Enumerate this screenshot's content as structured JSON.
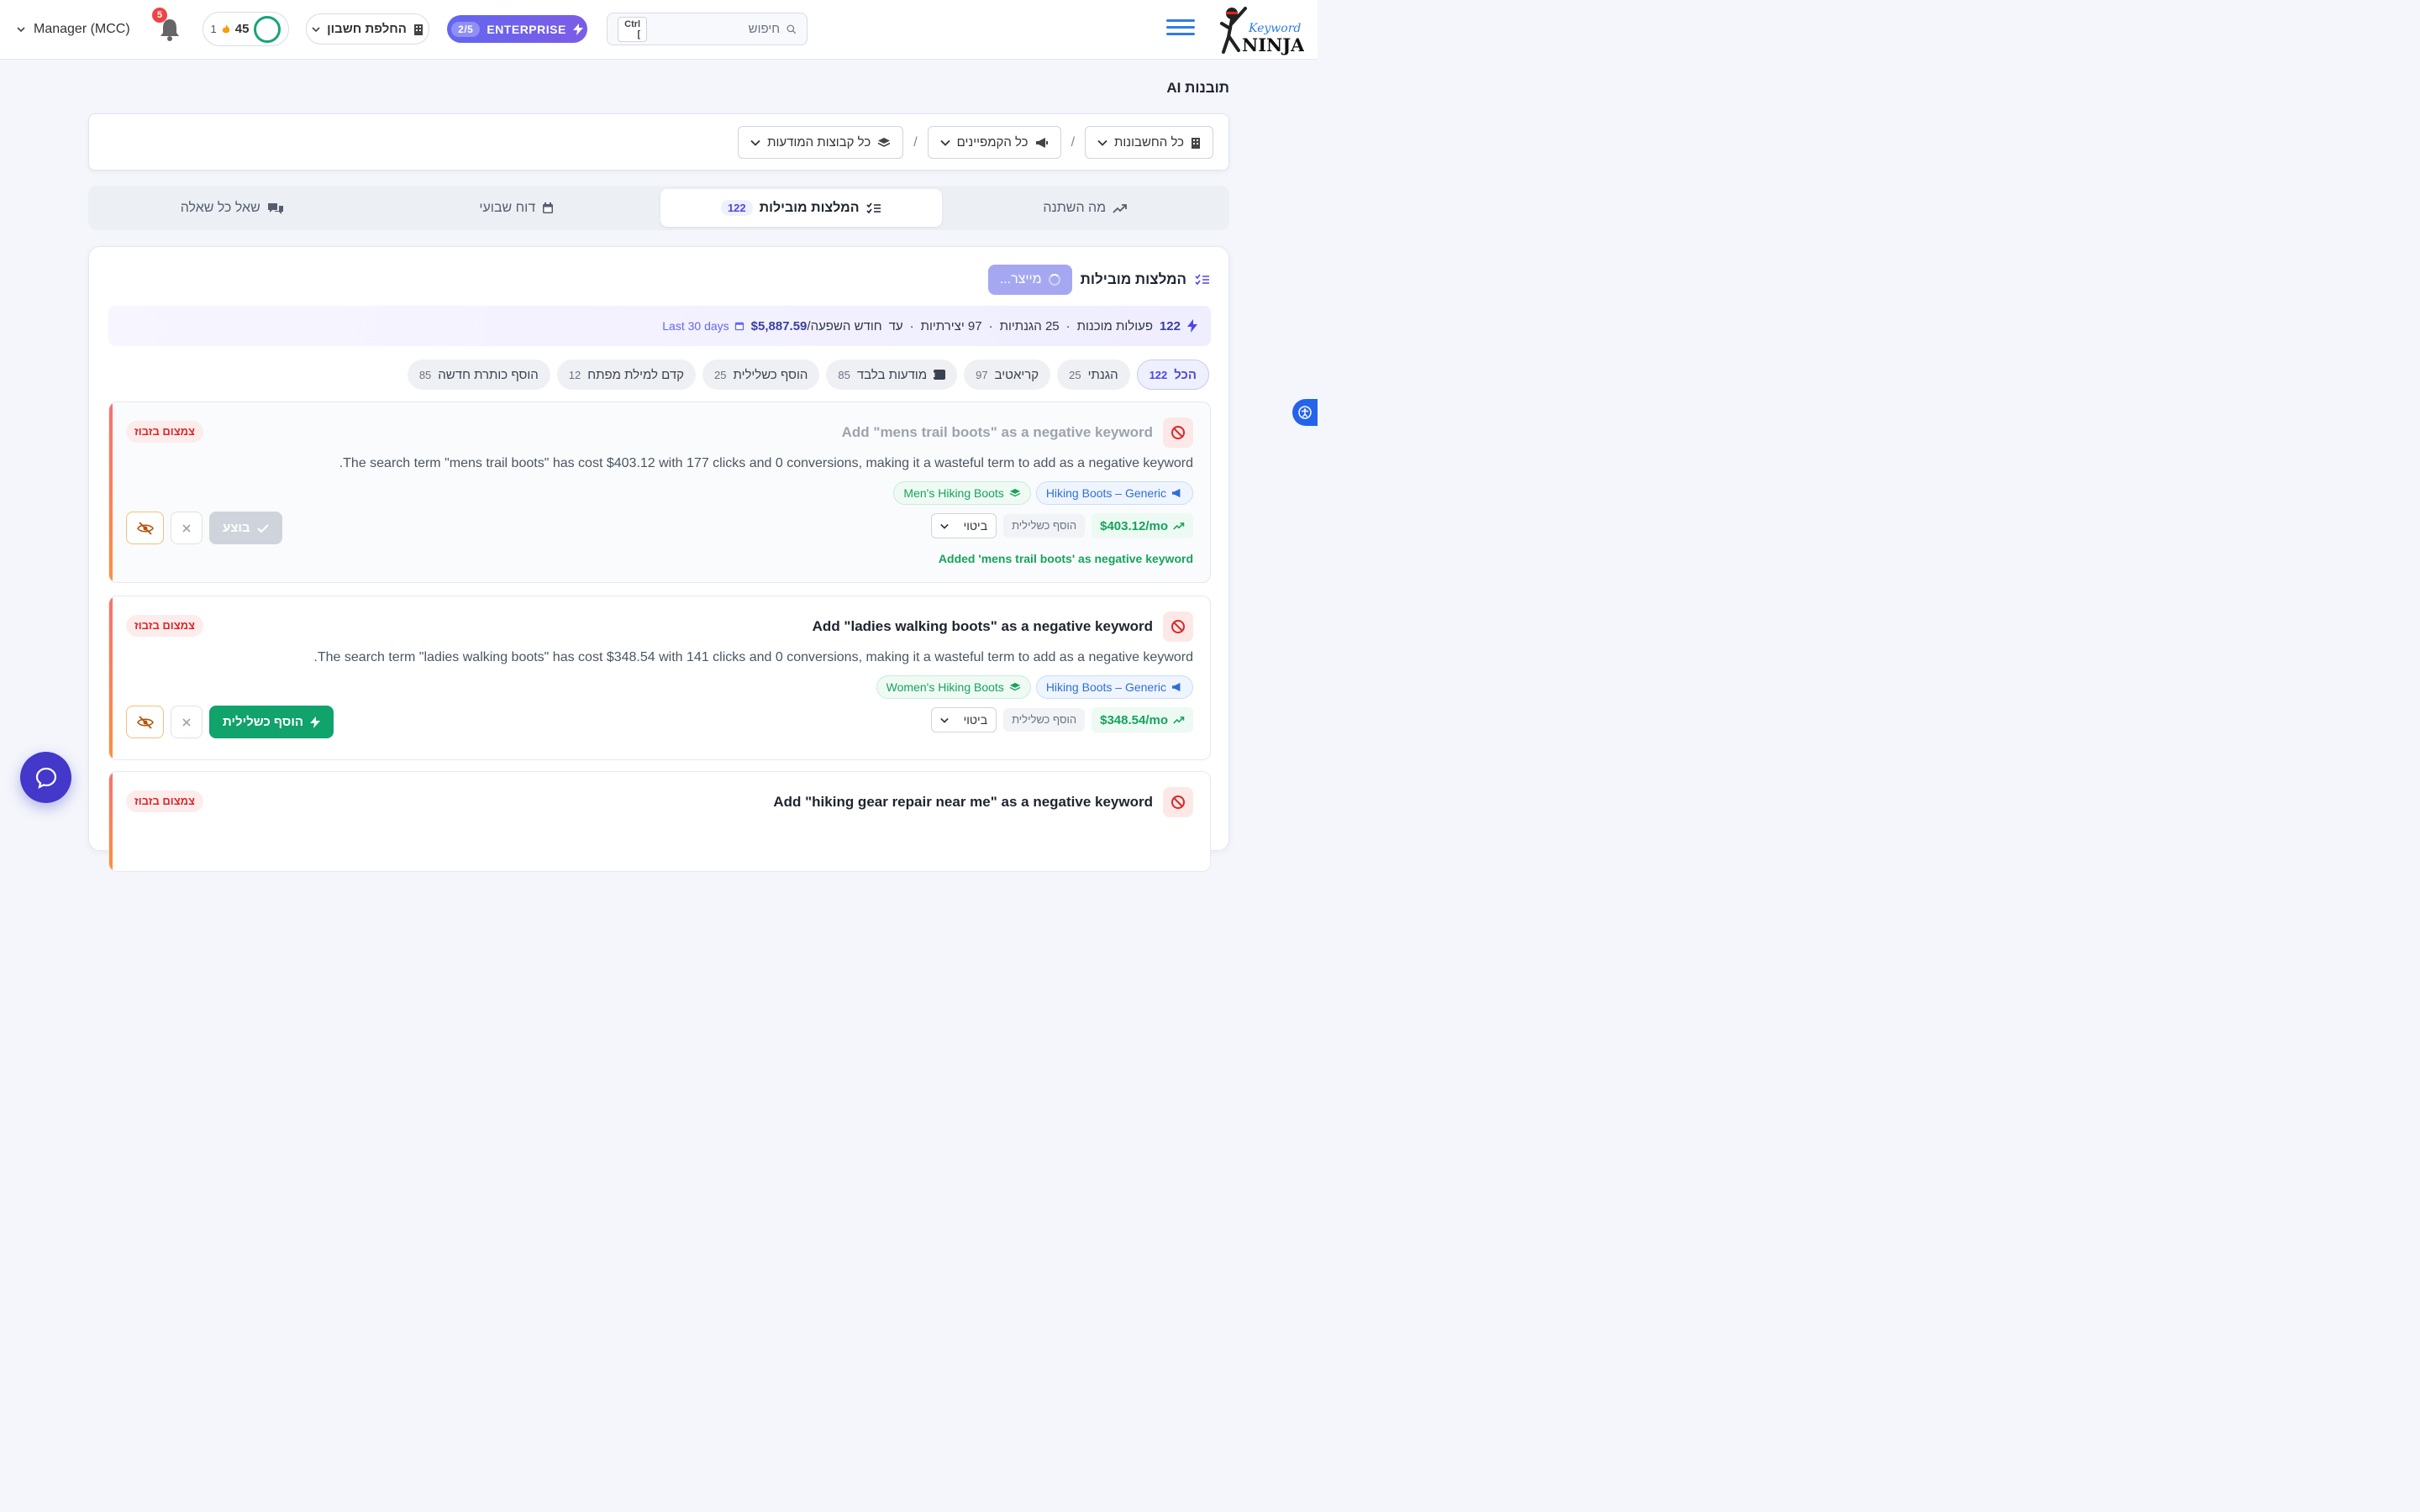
{
  "header": {
    "logo_text_top": "Keyword",
    "logo_text_bottom": "NINJA",
    "search_placeholder": "חיפוש",
    "search_shortcut": "Ctrl ]",
    "plan_label": "ENTERPRISE",
    "plan_count": "2/5",
    "switch_account_label": "החלפת חשבון",
    "score_value": "45",
    "streak_value": "1",
    "notifications_count": "5",
    "user_label": "Manager (MCC)"
  },
  "page": {
    "title": "תובנות AI"
  },
  "filters": {
    "accounts": "כל החשבונות",
    "campaigns": "כל הקמפיינים",
    "ad_groups": "כל קבוצות המודעות",
    "separator": "/"
  },
  "tabs": [
    {
      "label": "מה השתנה"
    },
    {
      "label": "המלצות מובילות",
      "count": "122"
    },
    {
      "label": "דוח שבועי"
    },
    {
      "label": "שאל כל שאלה"
    }
  ],
  "section": {
    "title": "המלצות מובילות",
    "generating_label": "מייצר..."
  },
  "summary": {
    "actions_count": "122",
    "actions_label": "פעולות מוכנות",
    "defensive": "25 הגנתיות",
    "creative": "97 יצירתיות",
    "impact_prefix": "עד",
    "impact_value": "$5,887.59",
    "impact_suffix": "/חודש השפעה",
    "period": "Last 30 days",
    "dot": "·"
  },
  "chips": [
    {
      "label": "הכל",
      "count": "122"
    },
    {
      "label": "הגנתי",
      "count": "25"
    },
    {
      "label": "קריאטיב",
      "count": "97"
    },
    {
      "label": "מודעות בלבד",
      "count": "85"
    },
    {
      "label": "הוסף כשלילית",
      "count": "25"
    },
    {
      "label": "קדם למילת מפתח",
      "count": "12"
    },
    {
      "label": "הוסף כותרת חדשה",
      "count": "85"
    }
  ],
  "recommendations": [
    {
      "title": "Add \"mens trail boots\" as a negative keyword",
      "badge": "צמצום בזבוז",
      "description": "The search term \"mens trail boots\" has cost $403.12 with 177 clicks and 0 conversions, making it a wasteful term to add as a negative keyword.",
      "campaign": "Hiking Boots – Generic",
      "ad_group": "Men's Hiking Boots",
      "impact": "$403.12/mo",
      "type_label": "הוסף כשלילית",
      "match_type": "ביטוי",
      "action_label": "בוצע",
      "result": "Added 'mens trail boots' as negative keyword"
    },
    {
      "title": "Add \"ladies walking boots\" as a negative keyword",
      "badge": "צמצום בזבוז",
      "description": "The search term \"ladies walking boots\" has cost $348.54 with 141 clicks and 0 conversions, making it a wasteful term to add as a negative keyword.",
      "campaign": "Hiking Boots – Generic",
      "ad_group": "Women's Hiking Boots",
      "impact": "$348.54/mo",
      "type_label": "הוסף כשלילית",
      "match_type": "ביטוי",
      "action_label": "הוסף כשלילית"
    },
    {
      "title": "Add \"hiking gear repair near me\" as a negative keyword",
      "badge": "צמצום בזבוז"
    }
  ],
  "colors": {
    "accent": "#6366f1",
    "success": "#10a36b",
    "danger": "#dc2626",
    "chat": "#4338ca"
  }
}
